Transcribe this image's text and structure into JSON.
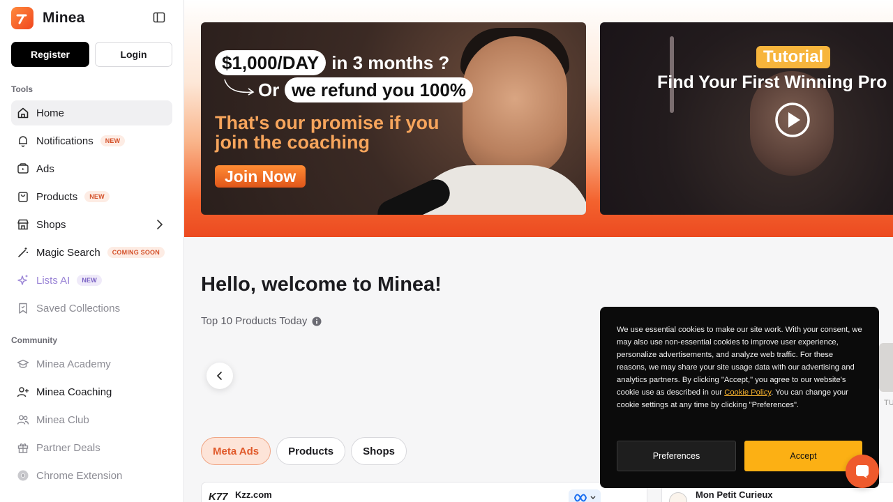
{
  "brand": {
    "name": "Minea"
  },
  "auth": {
    "register": "Register",
    "login": "Login"
  },
  "sections": {
    "tools": "Tools",
    "community": "Community"
  },
  "nav": {
    "home": "Home",
    "notifications": "Notifications",
    "notifications_badge": "NEW",
    "ads": "Ads",
    "products": "Products",
    "products_badge": "NEW",
    "shops": "Shops",
    "magic_search": "Magic Search",
    "magic_search_badge": "COMING SOON",
    "lists_ai": "Lists AI",
    "lists_ai_badge": "NEW",
    "saved_collections": "Saved Collections",
    "academy": "Minea Academy",
    "coaching": "Minea Coaching",
    "club": "Minea Club",
    "partner_deals": "Partner Deals",
    "chrome_extension": "Chrome Extension"
  },
  "banner1": {
    "amount": "$1,000/DAY",
    "in_months": "in 3 months ?",
    "or": "Or",
    "refund": "we refund you 100%",
    "promise": "That's our promise if you join the coaching",
    "cta": "Join Now"
  },
  "banner2": {
    "tag": "Tutorial",
    "title": "Find Your First Winning Pro"
  },
  "main": {
    "greeting": "Hello, welcome to Minea!",
    "top10": "Top 10 Products Today"
  },
  "tabs": [
    "Meta Ads",
    "Products",
    "Shops"
  ],
  "cards": {
    "left_logo": "K77",
    "left_name": "Kzz.com",
    "right_name": "Mon Petit Curieux",
    "peek_text": "TU"
  },
  "cookie": {
    "text_before": "We use essential cookies to make our site work. With your consent, we may also use non-essential cookies to improve user experience, personalize advertisements, and analyze web traffic. For these reasons, we may share your site usage data with our advertising and analytics partners. By clicking \"Accept,\" you agree to our website's cookie use as described in our ",
    "link": "Cookie Policy",
    "text_after": ". You can change your cookie settings at any time by clicking \"Preferences\".",
    "preferences": "Preferences",
    "accept": "Accept"
  },
  "colors": {
    "accent": "#ef5a2c",
    "accept": "#fcb014"
  }
}
